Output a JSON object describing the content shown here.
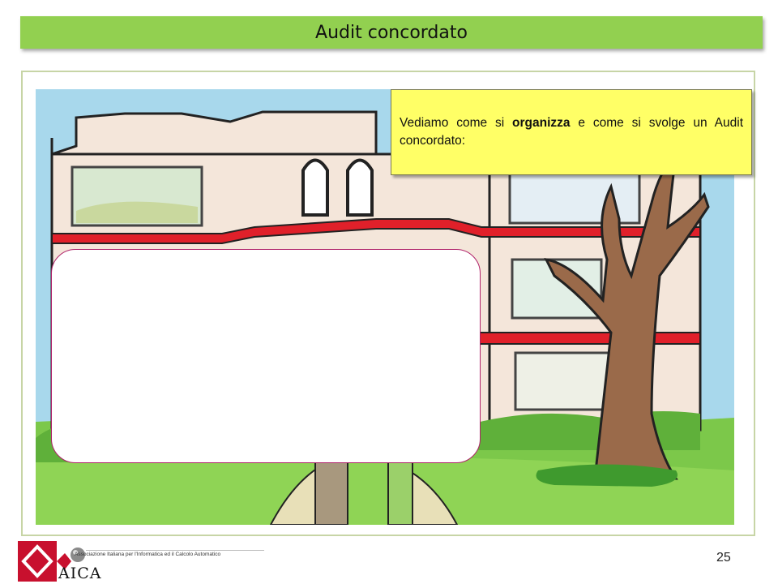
{
  "slide": {
    "title": "Audit concordato",
    "page_number": "25"
  },
  "callout": {
    "text_before": "Vediamo come si ",
    "text_bold": "organizza",
    "text_after": " e come si svolge un Audit concordato:"
  },
  "footer": {
    "logo_subtitle": "Associazione Italiana per l'Informatica ed il Calcolo Automatico",
    "logo_wordmark": "AICA"
  },
  "colors": {
    "title_bar": "#92d050",
    "callout_fill": "#ffff66",
    "box_border": "#b0226a",
    "logo_red": "#c8102e"
  },
  "illustration": {
    "icon": "school-building-illustration"
  }
}
